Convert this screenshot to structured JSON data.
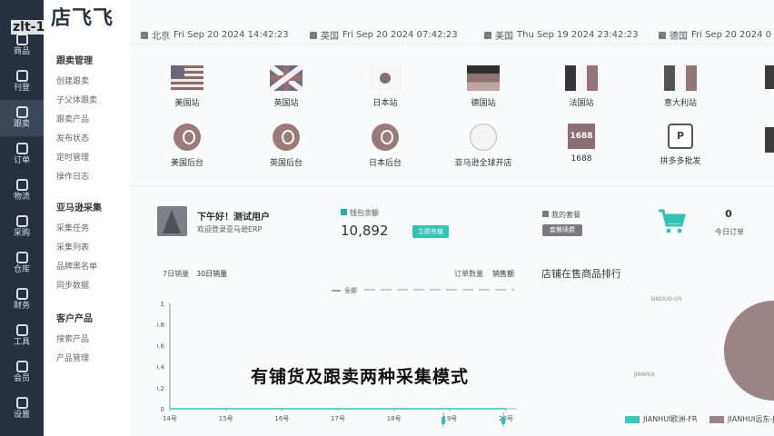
{
  "app": {
    "logo": "店飞飞",
    "user_tag": "zlt-1"
  },
  "rail": [
    {
      "label": "商品",
      "icon": "box-icon"
    },
    {
      "label": "刊登",
      "icon": "publish-icon"
    },
    {
      "label": "跟卖",
      "icon": "follow-icon"
    },
    {
      "label": "订单",
      "icon": "order-icon"
    },
    {
      "label": "物流",
      "icon": "truck-icon"
    },
    {
      "label": "采购",
      "icon": "cart-icon"
    },
    {
      "label": "仓库",
      "icon": "warehouse-icon"
    },
    {
      "label": "财务",
      "icon": "finance-icon"
    },
    {
      "label": "工具",
      "icon": "tool-icon"
    },
    {
      "label": "会员",
      "icon": "member-icon"
    },
    {
      "label": "设置",
      "icon": "settings-icon"
    }
  ],
  "menu": {
    "sections": [
      {
        "title": "跟卖管理",
        "items": [
          "创建跟卖",
          "子父体跟卖",
          "跟卖产品",
          "发布状态",
          "定时管理",
          "操作日志"
        ]
      },
      {
        "title": "亚马逊采集",
        "items": [
          "采集任务",
          "采集列表",
          "品牌黑名单",
          "同步数据"
        ]
      },
      {
        "title": "客户产品",
        "items": [
          "搜索产品",
          "产品管理"
        ]
      }
    ]
  },
  "clocks": [
    {
      "city": "北京",
      "time": "Fri Sep 20 2024 14:42:23"
    },
    {
      "city": "英国",
      "time": "Fri Sep 20 2024 07:42:23"
    },
    {
      "city": "美国",
      "time": "Thu Sep 19 2024 23:42:23"
    },
    {
      "city": "德国",
      "time": "Fri Sep 20 2024 0"
    }
  ],
  "sites_row1": [
    {
      "label": "美国站",
      "icon": "us-flag-icon"
    },
    {
      "label": "英国站",
      "icon": "uk-flag-icon"
    },
    {
      "label": "日本站",
      "icon": "jp-flag-icon"
    },
    {
      "label": "德国站",
      "icon": "de-flag-icon"
    },
    {
      "label": "法国站",
      "icon": "fr-flag-icon"
    },
    {
      "label": "意大利站",
      "icon": "it-flag-icon"
    }
  ],
  "sites_row2": [
    {
      "label": "美国后台",
      "icon": "location-pin-icon"
    },
    {
      "label": "英国后台",
      "icon": "location-pin-icon"
    },
    {
      "label": "日本后台",
      "icon": "location-pin-icon"
    },
    {
      "label": "亚马逊全球开店",
      "icon": "amazon-global-icon"
    },
    {
      "label": "1688",
      "icon": "1688-logo-icon",
      "logo_text": "1688"
    },
    {
      "label": "拼多多批发",
      "icon": "pinduoduo-icon",
      "logo_text": "P"
    }
  ],
  "user": {
    "greeting": "下午好！测试用户",
    "welcome": "欢迎登录亚马逊ERP"
  },
  "balance": {
    "label": "钱包余额",
    "value": "10,892",
    "button": "立即充值"
  },
  "package": {
    "label": "我的套餐",
    "button": "套餐续费"
  },
  "orders": {
    "count": "0",
    "label": "今日订单"
  },
  "chart_tabs": {
    "sales": "7日销量",
    "sales30": "30日销量",
    "order_count": "订单数量",
    "amount": "销售额"
  },
  "rank_title": "店铺在售商品排行",
  "chart_data": [
    {
      "type": "line",
      "x": [
        "14号",
        "15号",
        "16号",
        "17号",
        "18号",
        "19号",
        "20号"
      ],
      "series": [
        {
          "name": "全部",
          "values": [
            0,
            0,
            0,
            0,
            0,
            0,
            0
          ]
        }
      ],
      "yticks": [
        "1",
        "0.8",
        "0.6",
        "0.4",
        "0.2",
        "0"
      ],
      "ylim": [
        0,
        1
      ],
      "legend": "top-center",
      "grid": false
    },
    {
      "type": "pie",
      "slices": [
        {
          "name": "JIANHUI欧洲-FR",
          "value": 0.38,
          "color": "#35c9c0"
        },
        {
          "name": "JIANHUI远东-JP",
          "value": 0.62,
          "color": "#9b8486"
        }
      ],
      "labels": [
        "SINDUO-US",
        "JIANHUI"
      ]
    }
  ],
  "subtitle": "有铺货及跟卖两种采集模式"
}
